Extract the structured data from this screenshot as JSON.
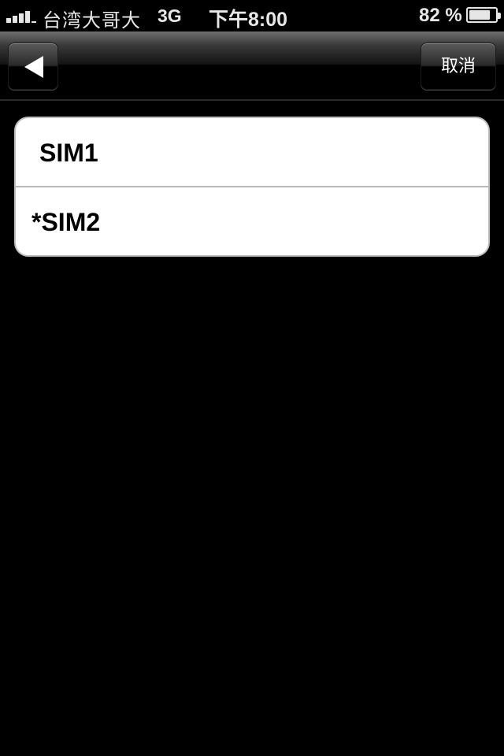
{
  "status_bar": {
    "carrier": "台湾大哥大",
    "network": "3G",
    "time": "下午8:00",
    "battery_percent": "82 %",
    "battery_level": 0.82,
    "signal_bars": 4
  },
  "nav_bar": {
    "back_icon": "back-arrow-icon",
    "cancel_label": "取消"
  },
  "sim_list": {
    "items": [
      {
        "label": "SIM1"
      },
      {
        "label": "*SIM2"
      }
    ]
  },
  "colors": {
    "background": "#000000",
    "list_background": "#ffffff",
    "list_border": "#bdbdbd",
    "text_primary": "#000000",
    "nav_text": "#ffffff"
  }
}
